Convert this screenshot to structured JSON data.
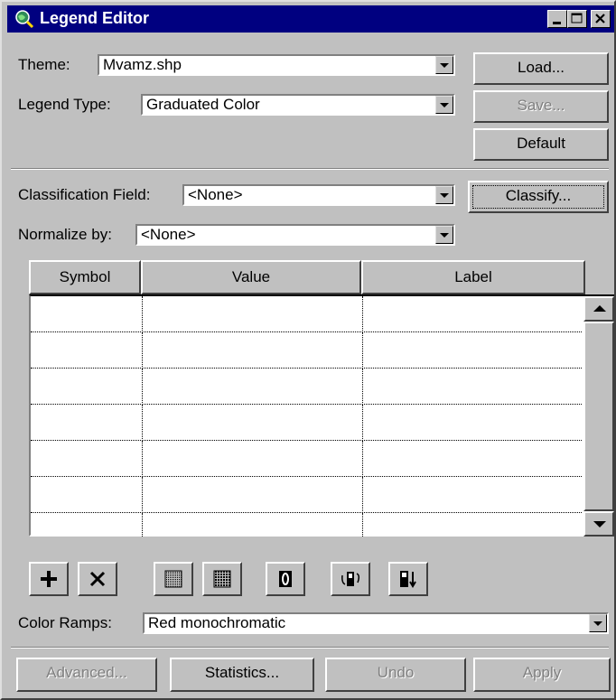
{
  "window": {
    "title": "Legend Editor",
    "icon": "globe-magnifier-icon",
    "controls": [
      "minimize-icon",
      "maximize-icon",
      "close-icon"
    ]
  },
  "theme": {
    "label": "Theme:",
    "value": "Mvamz.shp"
  },
  "legend_type": {
    "label": "Legend Type:",
    "value": "Graduated Color"
  },
  "side_buttons": {
    "load": "Load...",
    "save": "Save...",
    "default": "Default"
  },
  "classification_field": {
    "label": "Classification Field:",
    "value": "<None>"
  },
  "normalize_by": {
    "label": "Normalize by:",
    "value": "<None>"
  },
  "classify_button": "Classify...",
  "table": {
    "headers": [
      "Symbol",
      "Value",
      "Label"
    ],
    "rows": [
      [
        "",
        "",
        ""
      ],
      [
        "",
        "",
        ""
      ],
      [
        "",
        "",
        ""
      ],
      [
        "",
        "",
        ""
      ],
      [
        "",
        "",
        ""
      ],
      [
        "",
        "",
        ""
      ],
      [
        "",
        "",
        ""
      ]
    ]
  },
  "toolbar": {
    "icons": [
      "add-class-icon",
      "delete-class-icon",
      "fill-symbol-icon",
      "fill-pattern-icon",
      "null-value-icon",
      "flip-symbols-icon",
      "sort-icon"
    ]
  },
  "color_ramps": {
    "label": "Color Ramps:",
    "value": "Red monochromatic"
  },
  "bottom_buttons": {
    "advanced": "Advanced...",
    "statistics": "Statistics...",
    "undo": "Undo",
    "apply": "Apply"
  },
  "colors": {
    "titlebar": "#000080",
    "face": "#c0c0c0",
    "disabled_text": "#808080"
  }
}
